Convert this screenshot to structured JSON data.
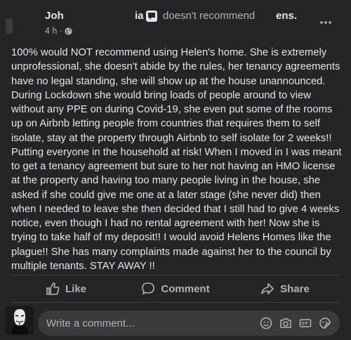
{
  "post": {
    "author_visible": "Joh",
    "author_tail": "ia",
    "recommend_text": "doesn't recommend",
    "page_tail": "ens.",
    "time": "4 h ·",
    "text": "100% would NOT recommend using Helen's home. She is extremely unprofessional, she doesn't abide by the rules, her tenancy agreements have no legal standing, she will show up at the house unannounced. During Lockdown she would bring loads of people around to view without any PPE on during Covid-19, she even put some of the rooms up on Airbnb letting people from countries that requires them to self isolate, stay at the property through Airbnb to self isolate for 2 weeks!! Putting everyone in the household at risk! When I moved in I was meant to get a tenancy agreement but sure to her not having an HMO license at the property and having too many people living in the house, she asked if she could give me one at a later stage (she never did) then when I needed to leave she then decided that I still had to give 4 weeks notice, even though I had no rental agreement with her! Now she is trying to take half of my deposit!!  I would avoid Helens Homes like the plague!! She has many complaints made against her to the council by multiple tenants. STAY AWAY !!"
  },
  "actions": {
    "like": "Like",
    "comment": "Comment",
    "share": "Share"
  },
  "comment": {
    "placeholder": "Write a comment..."
  },
  "icons": [
    "recommend-icon",
    "globe-icon",
    "more-icon",
    "like-icon",
    "comment-icon",
    "share-icon",
    "emoji-icon",
    "camera-icon",
    "gif-icon",
    "sticker-icon"
  ]
}
